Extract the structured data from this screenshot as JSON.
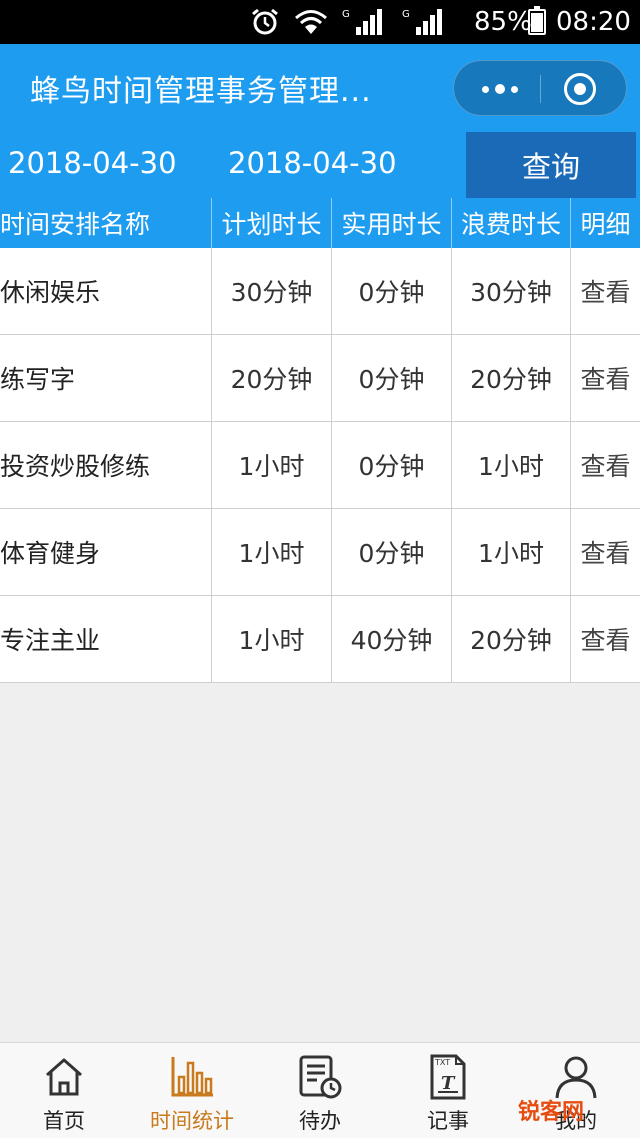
{
  "status_bar": {
    "battery_percent": "85%",
    "time": "08:20",
    "battery_level": 0.85,
    "icons": [
      "alarm-icon",
      "wifi-icon",
      "signal-icon",
      "signal-icon"
    ]
  },
  "header": {
    "title": "蜂鸟时间管理事务管理...",
    "colors": {
      "primary": "#1e9cf0",
      "button": "#1a6ab8"
    }
  },
  "filter": {
    "start_date": "2018-04-30",
    "end_date": "2018-04-30",
    "query_label": "查询"
  },
  "table": {
    "headers": [
      "时间安排名称",
      "计划时长",
      "实用时长",
      "浪费时长",
      "明细"
    ],
    "rows": [
      {
        "name": "休闲娱乐",
        "planned": "30分钟",
        "actual": "0分钟",
        "wasted": "30分钟",
        "detail": "查看"
      },
      {
        "name": "练写字",
        "planned": "20分钟",
        "actual": "0分钟",
        "wasted": "20分钟",
        "detail": "查看"
      },
      {
        "name": "投资炒股修练",
        "planned": "1小时",
        "actual": "0分钟",
        "wasted": "1小时",
        "detail": "查看"
      },
      {
        "name": "体育健身",
        "planned": "1小时",
        "actual": "0分钟",
        "wasted": "1小时",
        "detail": "查看"
      },
      {
        "name": "专注主业",
        "planned": "1小时",
        "actual": "40分钟",
        "wasted": "20分钟",
        "detail": "查看"
      }
    ]
  },
  "tabbar": {
    "items": [
      {
        "label": "首页",
        "icon": "home-icon",
        "active": false
      },
      {
        "label": "时间统计",
        "icon": "bar-chart-icon",
        "active": true
      },
      {
        "label": "待办",
        "icon": "todo-clock-icon",
        "active": false
      },
      {
        "label": "记事",
        "icon": "text-file-icon",
        "active": false
      },
      {
        "label": "我的",
        "icon": "user-icon",
        "active": false
      }
    ],
    "active_color": "#c87a1c"
  },
  "watermark": {
    "text": "锐客网"
  }
}
